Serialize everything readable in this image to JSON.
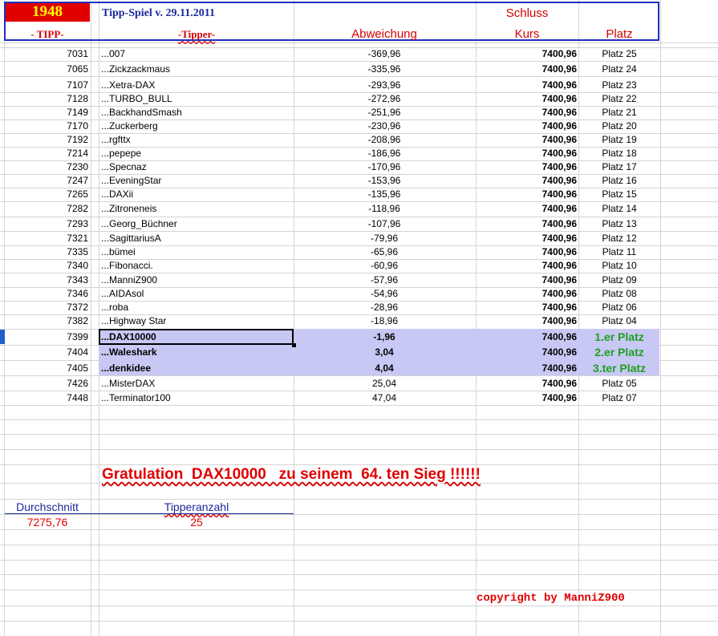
{
  "header": {
    "year": "1948",
    "title": "Tipp-Spiel v. 29.11.2011",
    "schluss": "Schluss",
    "col_tipp": "- TIPP-",
    "col_tipper": "-Tipper-",
    "col_abweichung": "Abweichung",
    "col_kurs": "Kurs",
    "col_platz": "Platz"
  },
  "rows": [
    {
      "tipp": "7031",
      "name": "...007",
      "abw": "-369,96",
      "kurs": "7400,96",
      "platz": "Platz 25"
    },
    {
      "tipp": "7065",
      "name": "...Zickzackmaus",
      "abw": "-335,96",
      "kurs": "7400,96",
      "platz": "Platz 24"
    },
    {
      "tipp": "7107",
      "name": "...Xetra-DAX",
      "abw": "-293,96",
      "kurs": "7400,96",
      "platz": "Platz 23"
    },
    {
      "tipp": "7128",
      "name": "...TURBO_BULL",
      "abw": "-272,96",
      "kurs": "7400,96",
      "platz": "Platz 22"
    },
    {
      "tipp": "7149",
      "name": "...BackhandSmash",
      "abw": "-251,96",
      "kurs": "7400,96",
      "platz": "Platz 21"
    },
    {
      "tipp": "7170",
      "name": "...Zuckerberg",
      "abw": "-230,96",
      "kurs": "7400,96",
      "platz": "Platz 20"
    },
    {
      "tipp": "7192",
      "name": "...rgfttx",
      "abw": "-208,96",
      "kurs": "7400,96",
      "platz": "Platz 19"
    },
    {
      "tipp": "7214",
      "name": "...pepepe",
      "abw": "-186,96",
      "kurs": "7400,96",
      "platz": "Platz 18"
    },
    {
      "tipp": "7230",
      "name": "...Specnaz",
      "abw": "-170,96",
      "kurs": "7400,96",
      "platz": "Platz 17"
    },
    {
      "tipp": "7247",
      "name": "...EveningStar",
      "abw": "-153,96",
      "kurs": "7400,96",
      "platz": "Platz 16"
    },
    {
      "tipp": "7265",
      "name": "...DAXii",
      "abw": "-135,96",
      "kurs": "7400,96",
      "platz": "Platz 15"
    },
    {
      "tipp": "7282",
      "name": "...Zitroneneis",
      "abw": "-118,96",
      "kurs": "7400,96",
      "platz": "Platz 14"
    },
    {
      "tipp": "7293",
      "name": "...Georg_Büchner",
      "abw": "-107,96",
      "kurs": "7400,96",
      "platz": "Platz 13"
    },
    {
      "tipp": "7321",
      "name": "...SagittariusA",
      "abw": "-79,96",
      "kurs": "7400,96",
      "platz": "Platz 12"
    },
    {
      "tipp": "7335",
      "name": "...bümei",
      "abw": "-65,96",
      "kurs": "7400,96",
      "platz": "Platz 11"
    },
    {
      "tipp": "7340",
      "name": "...Fibonacci.",
      "abw": "-60,96",
      "kurs": "7400,96",
      "platz": "Platz 10"
    },
    {
      "tipp": "7343",
      "name": "...ManniZ900",
      "abw": "-57,96",
      "kurs": "7400,96",
      "platz": "Platz 09"
    },
    {
      "tipp": "7346",
      "name": "...AIDAsol",
      "abw": "-54,96",
      "kurs": "7400,96",
      "platz": "Platz 08"
    },
    {
      "tipp": "7372",
      "name": "...roba",
      "abw": "-28,96",
      "kurs": "7400,96",
      "platz": "Platz 06"
    },
    {
      "tipp": "7382",
      "name": "...Highway Star",
      "abw": "-18,96",
      "kurs": "7400,96",
      "platz": "Platz 04"
    },
    {
      "tipp": "7399",
      "name": "...DAX10000",
      "abw": "-1,96",
      "kurs": "7400,96",
      "platz": "1.er Platz"
    },
    {
      "tipp": "7404",
      "name": "...Waleshark",
      "abw": "3,04",
      "kurs": "7400,96",
      "platz": "2.er Platz"
    },
    {
      "tipp": "7405",
      "name": "...denkidee",
      "abw": "4,04",
      "kurs": "7400,96",
      "platz": "3.ter Platz"
    },
    {
      "tipp": "7426",
      "name": "...MisterDAX",
      "abw": "25,04",
      "kurs": "7400,96",
      "platz": "Platz 05"
    },
    {
      "tipp": "7448",
      "name": "...Terminator100",
      "abw": "47,04",
      "kurs": "7400,96",
      "platz": "Platz 07"
    }
  ],
  "footer": {
    "gratulation": "Gratulation  DAX10000   zu seinem  64. ten Sieg !!!!!!",
    "durchschnitt_label": "Durchschnitt",
    "durchschnitt_value": "7275,76",
    "tipperanzahl_label": "Tipperanzahl",
    "tipperanzahl_value": "25",
    "copyright": "copyright by ManniZ900"
  },
  "colors": {
    "header_frame": "#1f2fbf",
    "year_bg": "#e00000",
    "year_text": "#ffff00",
    "highlight_rows": "#c8c8f4",
    "podium_text": "#1ea01e",
    "accent_red": "#e00000"
  }
}
